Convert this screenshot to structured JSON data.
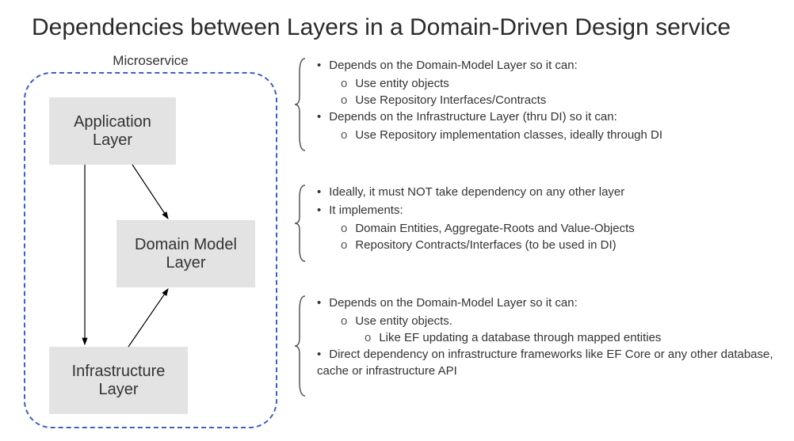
{
  "title": "Dependencies between Layers in a Domain-Driven Design service",
  "microservice_label": "Microservice",
  "layers": {
    "application": "Application Layer",
    "domain": "Domain Model Layer",
    "infrastructure": "Infrastructure Layer"
  },
  "descriptions": {
    "application": {
      "items": [
        "Depends on the Domain-Model Layer so it can:",
        "Depends on the Infrastructure Layer (thru DI) so it can:"
      ],
      "sub1": [
        "Use entity objects",
        "Use Repository Interfaces/Contracts"
      ],
      "sub2": [
        "Use Repository implementation classes, ideally through DI"
      ]
    },
    "domain": {
      "items": [
        "Ideally, it must NOT take dependency on any other layer",
        "It implements:"
      ],
      "sub1": [
        "Domain Entities, Aggregate-Roots and Value-Objects",
        "Repository Contracts/Interfaces (to be used in DI)"
      ]
    },
    "infrastructure": {
      "items": [
        "Depends on the Domain-Model Layer so it can:",
        "Direct dependency on infrastructure frameworks like EF Core or any other database, cache or infrastructure API"
      ],
      "sub1": [
        "Use entity objects."
      ],
      "sub2": [
        "Like EF updating a database through mapped entities"
      ]
    }
  }
}
